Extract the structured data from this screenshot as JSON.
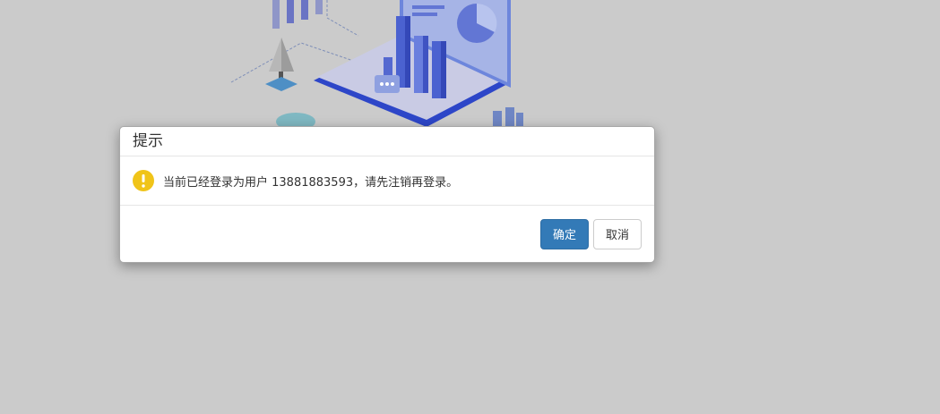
{
  "dialog": {
    "title": "提示",
    "message": "当前已经登录为用户 13881883593，请先注销再登录。",
    "confirm_label": "确定",
    "cancel_label": "取消",
    "icon": "warning-icon"
  },
  "colors": {
    "overlay": "#cbcbcb",
    "primary": "#337ab7",
    "warning": "#f0c419"
  }
}
